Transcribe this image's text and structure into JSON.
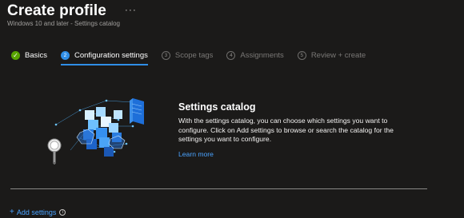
{
  "header": {
    "title": "Create profile",
    "more": "···",
    "subtitle": "Windows 10 and later - Settings catalog"
  },
  "steps": [
    {
      "number": "✓",
      "label": "Basics",
      "state": "done"
    },
    {
      "number": "2",
      "label": "Configuration settings",
      "state": "active"
    },
    {
      "number": "3",
      "label": "Scope tags",
      "state": "todo"
    },
    {
      "number": "4",
      "label": "Assignments",
      "state": "todo"
    },
    {
      "number": "5",
      "label": "Review + create",
      "state": "todo"
    }
  ],
  "info": {
    "heading": "Settings catalog",
    "body": "With the settings catalog, you can choose which settings you want to configure. Click on Add settings to browse or search the catalog for the settings you want to configure.",
    "link": "Learn more"
  },
  "add_settings": {
    "plus": "+",
    "label": "Add settings",
    "info_icon": "i"
  },
  "colors": {
    "background": "#1b1a19",
    "accent": "#2f8ee6",
    "link": "#4aa3ff",
    "success": "#57a300"
  }
}
